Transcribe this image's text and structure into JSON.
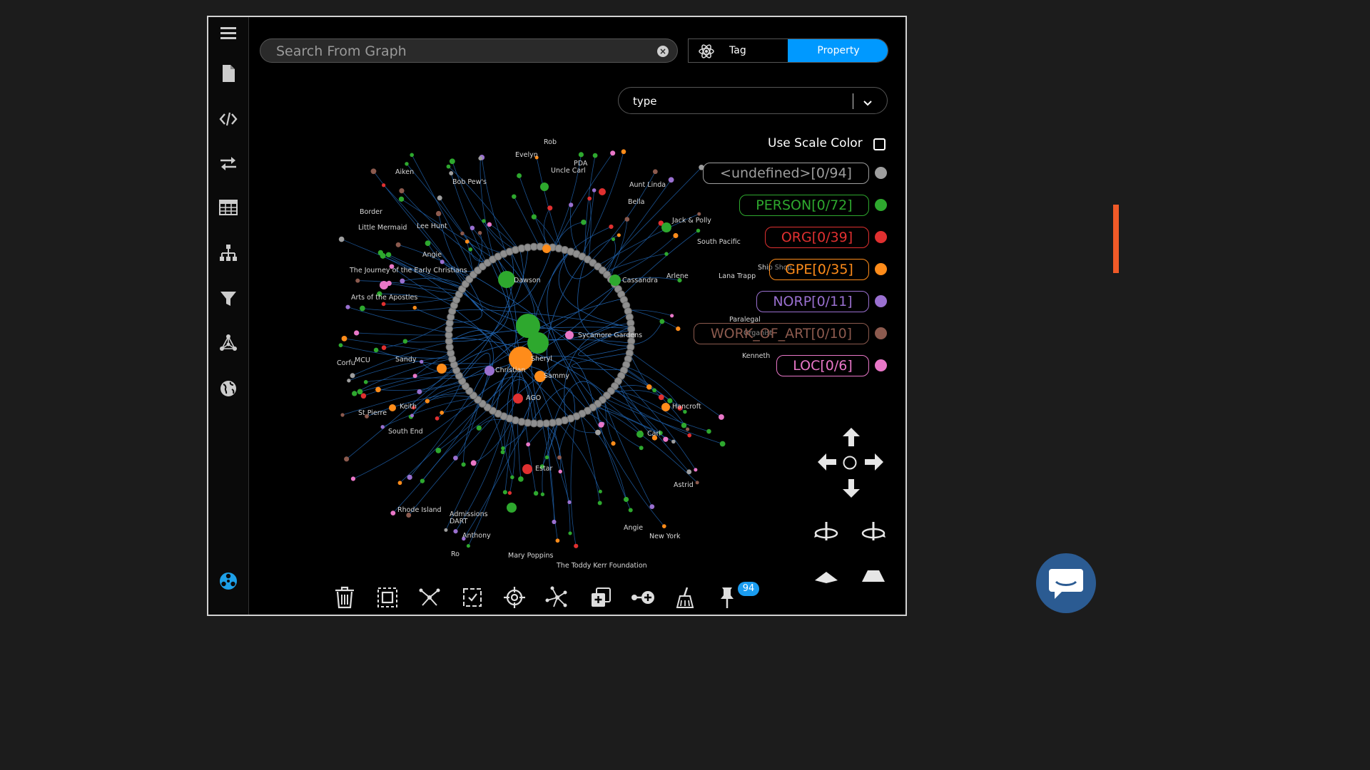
{
  "search": {
    "placeholder": "Search From Graph",
    "value": ""
  },
  "mode_toggle": {
    "tag_label": "Tag",
    "property_label": "Property",
    "active": "Property"
  },
  "property_select": {
    "value": "type"
  },
  "scale_color": {
    "label": "Use Scale Color",
    "checked": false
  },
  "legend": [
    {
      "label": "<undefined>[0/94]",
      "color": "#9e9e9e"
    },
    {
      "label": "PERSON[0/72]",
      "color": "#2ea82e"
    },
    {
      "label": "ORG[0/39]",
      "color": "#e03030"
    },
    {
      "label": "GPE[0/35]",
      "color": "#ff8c1a"
    },
    {
      "label": "NORP[0/11]",
      "color": "#9a70d0"
    },
    {
      "label": "WORK_OF_ART[0/10]",
      "color": "#8c5a4e"
    },
    {
      "label": "LOC[0/6]",
      "color": "#e977c8"
    }
  ],
  "toolbar": {
    "pin_count": "94"
  },
  "sidebar": {
    "items": [
      "menu-icon",
      "file-icon",
      "code-icon",
      "transfer-icon",
      "table-icon",
      "hierarchy-icon",
      "filter-icon",
      "graph-network-icon",
      "globe-icon"
    ],
    "bottom": "explorer-logo-icon"
  },
  "graph": {
    "labels": [
      {
        "t": "Rob"
      },
      {
        "t": "Evelyn"
      },
      {
        "t": "Aiken"
      },
      {
        "t": "Bob Pew's"
      },
      {
        "t": "Uncle Carl"
      },
      {
        "t": "PDA"
      },
      {
        "t": "Aunt Linda"
      },
      {
        "t": "Bella"
      },
      {
        "t": "Jack & Polly"
      },
      {
        "t": "South Pacific"
      },
      {
        "t": "Little Mermaid"
      },
      {
        "t": "Lee Hunt"
      },
      {
        "t": "Angie"
      },
      {
        "t": "Arts of the Apostles"
      },
      {
        "t": "Dawson"
      },
      {
        "t": "Cassandra"
      },
      {
        "t": "Arlene"
      },
      {
        "t": "Lana Trapp"
      },
      {
        "t": "Sycamore Gardens"
      },
      {
        "t": "Sheryl"
      },
      {
        "t": "Christian"
      },
      {
        "t": "Sammy"
      },
      {
        "t": "AGO"
      },
      {
        "t": "Hancroft"
      },
      {
        "t": "Carl"
      },
      {
        "t": "Keith"
      },
      {
        "t": "South End"
      },
      {
        "t": "Estar"
      },
      {
        "t": "Admissions"
      },
      {
        "t": "DART"
      },
      {
        "t": "Anthony"
      },
      {
        "t": "Ro"
      },
      {
        "t": "Mary Poppins"
      },
      {
        "t": "The Toddy Kerr Foundation"
      },
      {
        "t": "Angie"
      },
      {
        "t": "New York"
      },
      {
        "t": "Astrid"
      },
      {
        "t": "Ship Shop"
      },
      {
        "t": "Paralegal"
      },
      {
        "t": "Organist"
      },
      {
        "t": "Kenneth"
      },
      {
        "t": "St Pierre"
      },
      {
        "t": "Corfu"
      },
      {
        "t": "The Journey of the Early Christians"
      },
      {
        "t": "Border"
      },
      {
        "t": "Sandy"
      },
      {
        "t": "MCU"
      },
      {
        "t": "Rhode Island"
      }
    ]
  }
}
